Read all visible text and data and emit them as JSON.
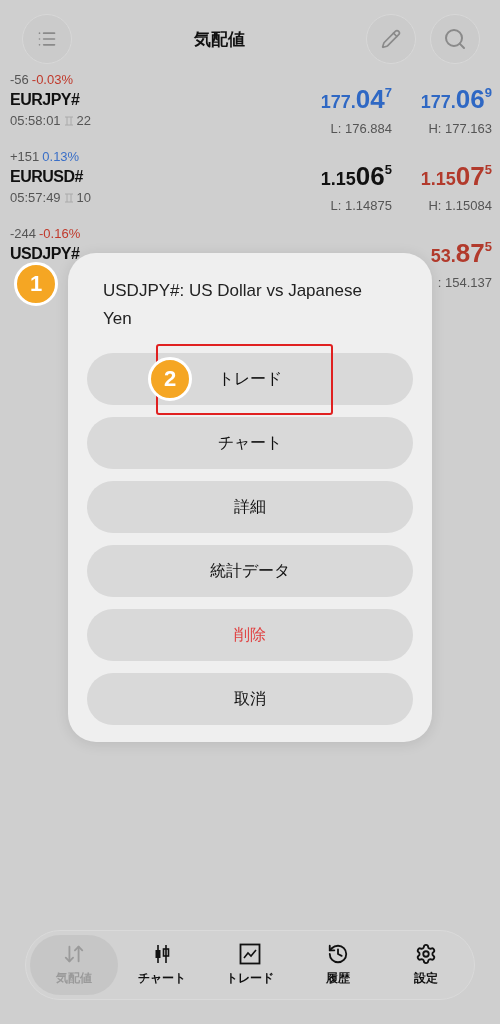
{
  "header": {
    "title": "気配値"
  },
  "quotes": [
    {
      "change": "-56",
      "change_pct": {
        "text": "-0.03%",
        "color": "#c0392b"
      },
      "symbol": "EURJPY#",
      "time": "05:58:01",
      "spread": "22",
      "bid": {
        "color": "#2f68c4",
        "prefix": "177.",
        "big": "04",
        "sup": "7"
      },
      "ask": {
        "color": "#2f68c4",
        "prefix": "177.",
        "big": "06",
        "sup": "9"
      },
      "low": "L: 176.884",
      "high": "H: 177.163"
    },
    {
      "change": "+151",
      "change_pct": {
        "text": "0.13%",
        "color": "#3a6fc7"
      },
      "symbol": "EURUSD#",
      "time": "05:57:49",
      "spread": "10",
      "bid": {
        "color": "#111111",
        "prefix": "1.15",
        "big": "06",
        "sup": "5"
      },
      "ask": {
        "color": "#b23a2c",
        "prefix": "1.15",
        "big": "07",
        "sup": "5"
      },
      "low": "L: 1.14875",
      "high": "H: 1.15084"
    },
    {
      "change": "-244",
      "change_pct": {
        "text": "-0.16%",
        "color": "#c0392b"
      },
      "symbol": "USDJPY#",
      "ask": {
        "color": "#b23a2c",
        "prefix": "53.",
        "big": "87",
        "sup": "5"
      },
      "high": ": 154.137"
    }
  ],
  "dialog": {
    "title": "USDJPY#: US Dollar vs Japanese Yen",
    "buttons": [
      {
        "label": "トレード",
        "kind": "normal"
      },
      {
        "label": "チャート",
        "kind": "normal"
      },
      {
        "label": "詳細",
        "kind": "normal"
      },
      {
        "label": "統計データ",
        "kind": "normal"
      },
      {
        "label": "削除",
        "kind": "danger"
      },
      {
        "label": "取消",
        "kind": "normal"
      }
    ]
  },
  "annotations": [
    {
      "label": "1"
    },
    {
      "label": "2"
    }
  ],
  "nav": [
    {
      "label": "気配値",
      "selected": true
    },
    {
      "label": "チャート",
      "selected": false
    },
    {
      "label": "トレード",
      "selected": false
    },
    {
      "label": "履歴",
      "selected": false
    },
    {
      "label": "設定",
      "selected": false
    }
  ]
}
